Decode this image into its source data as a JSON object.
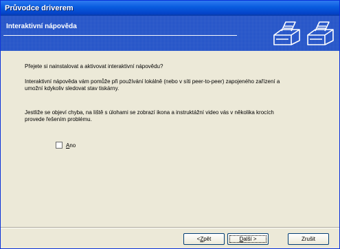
{
  "window": {
    "title": "Průvodce driverem"
  },
  "banner": {
    "title": "Interaktivní nápověda"
  },
  "content": {
    "question": "Přejete si nainstalovat a aktivovat interaktivní nápovědu?",
    "paragraph1_line1": "Interaktivní nápověda vám pomůže při používání lokálně (nebo v síti peer-to-peer) zapojeného zařízení a",
    "paragraph1_line2": "umožní kdykoliv sledovat stav tiskárny.",
    "paragraph2_line1": "Jestliže se objeví chyba, na liště s úlohami se zobrazí ikona a instruktážní video vás v několika krocích",
    "paragraph2_line2": "provede řešením problému.",
    "checkbox": {
      "label_access": "A",
      "label_rest": "no",
      "checked": false
    }
  },
  "buttons": {
    "back": {
      "prefix": "< ",
      "access": "Z",
      "rest": "pět"
    },
    "next": {
      "access": "D",
      "rest": "alší >"
    },
    "cancel": {
      "label": "Zrušit"
    }
  },
  "icons": [
    "printer-icon",
    "printer-icon"
  ]
}
